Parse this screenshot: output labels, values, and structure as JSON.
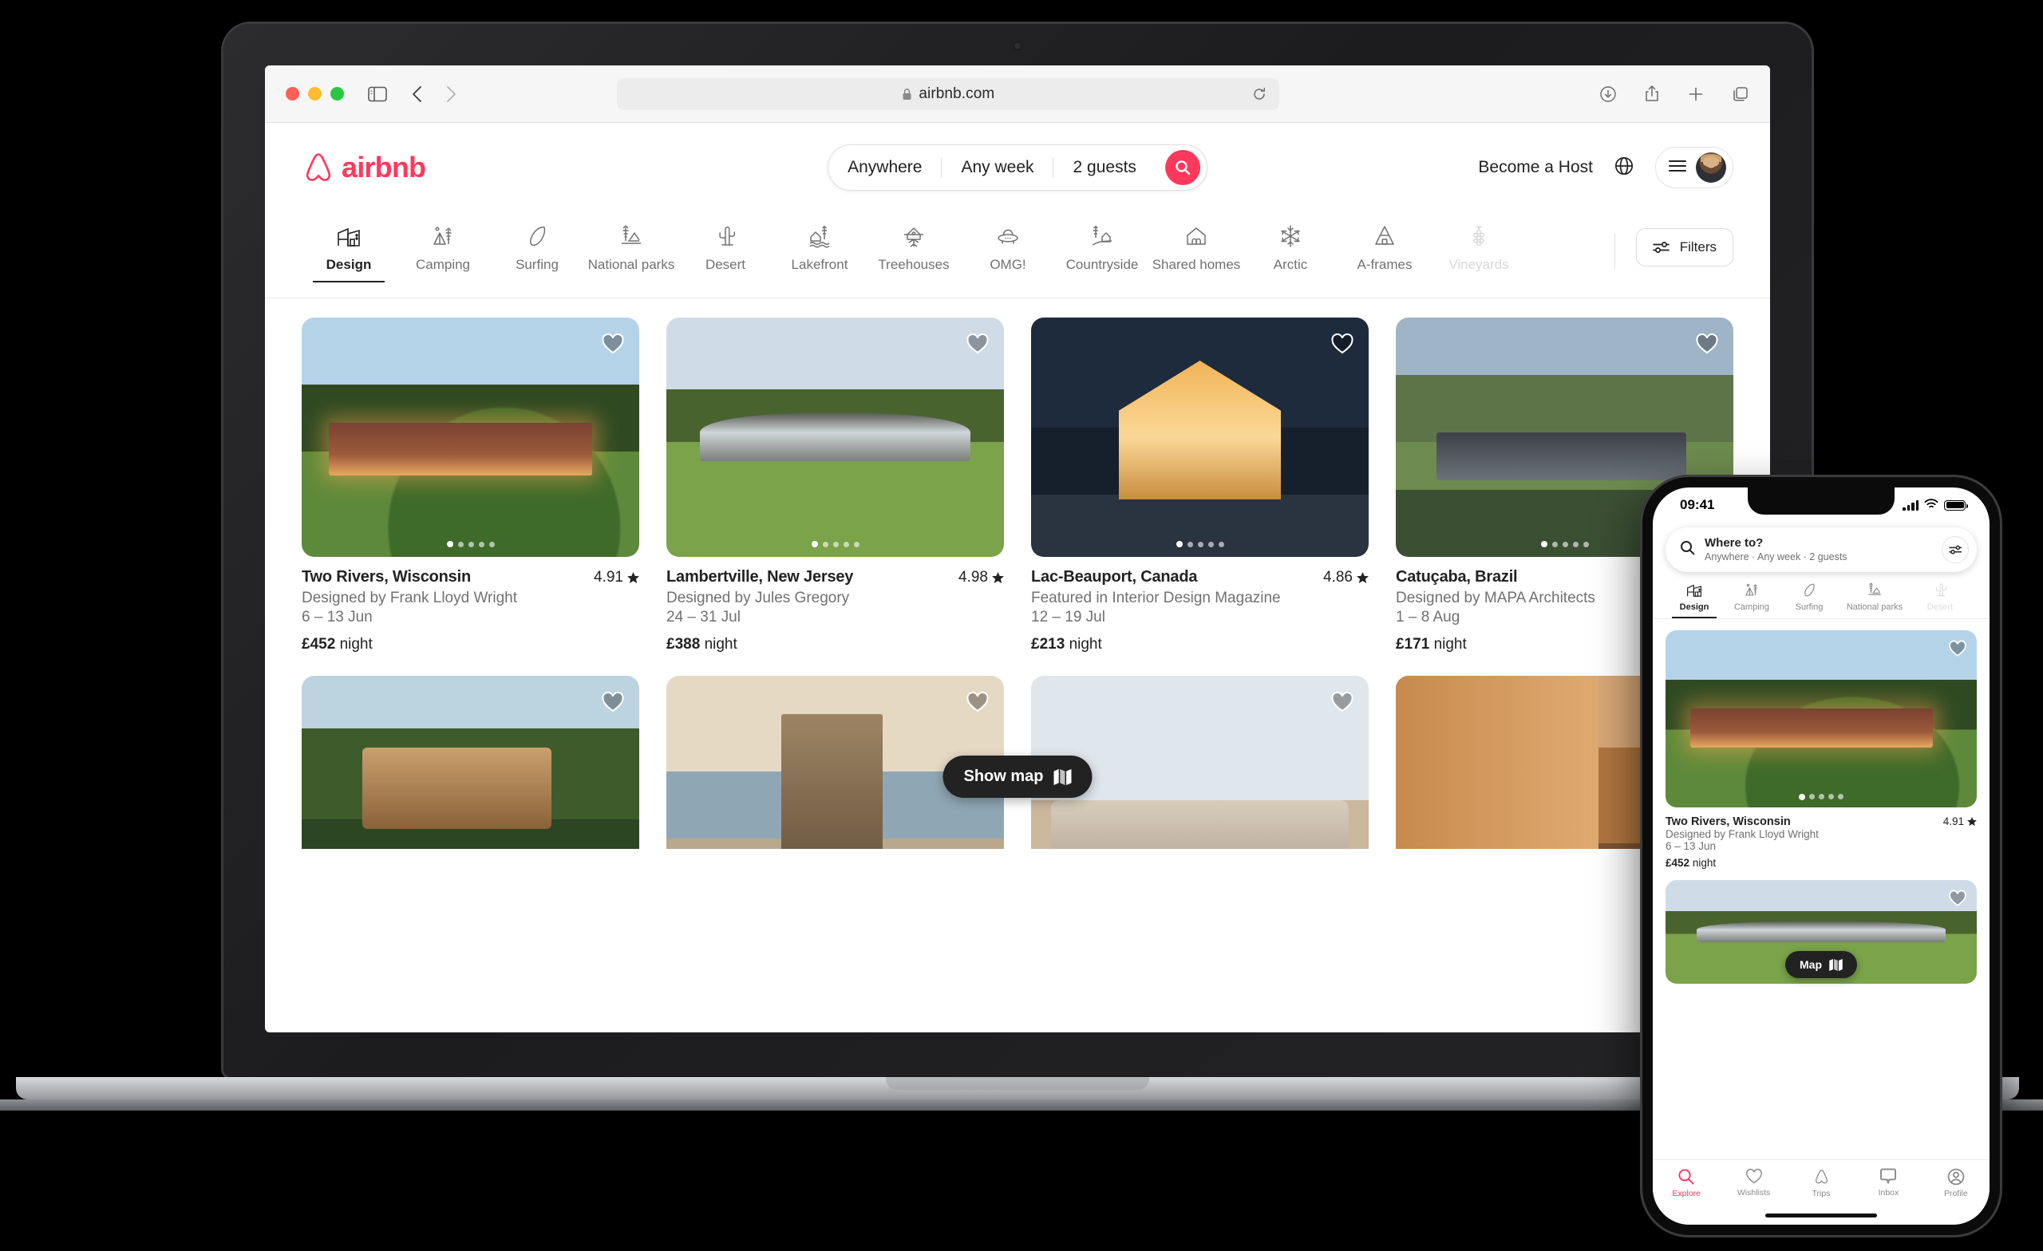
{
  "browser": {
    "url": "airbnb.com",
    "icons": {
      "sidebar": "sidebar-toggle-icon",
      "back": "back-arrow-icon",
      "forward": "forward-arrow-icon",
      "lock": "lock-icon",
      "reload": "reload-icon",
      "downloads": "downloads-icon",
      "share": "share-icon",
      "newtab": "plus-icon",
      "tabs": "tab-overview-icon"
    },
    "window_controls": [
      "close",
      "minimize",
      "zoom"
    ]
  },
  "site": {
    "brand": "airbnb",
    "search": {
      "location": "Anywhere",
      "dates": "Any week",
      "guests": "2 guests",
      "button": "search-icon"
    },
    "header": {
      "become_host": "Become a Host",
      "globe": "globe-icon",
      "menu": "hamburger-menu-icon",
      "avatar": "user-avatar"
    },
    "categories": [
      {
        "label": "Design",
        "icon": "design-building-icon",
        "active": true
      },
      {
        "label": "Camping",
        "icon": "camping-tent-icon",
        "active": false
      },
      {
        "label": "Surfing",
        "icon": "surfboard-icon",
        "active": false
      },
      {
        "label": "National parks",
        "icon": "national-park-icon",
        "active": false
      },
      {
        "label": "Desert",
        "icon": "cactus-icon",
        "active": false
      },
      {
        "label": "Lakefront",
        "icon": "lakefront-icon",
        "active": false
      },
      {
        "label": "Treehouses",
        "icon": "treehouse-icon",
        "active": false
      },
      {
        "label": "OMG!",
        "icon": "ufo-icon",
        "active": false
      },
      {
        "label": "Countryside",
        "icon": "countryside-icon",
        "active": false
      },
      {
        "label": "Shared homes",
        "icon": "shared-home-icon",
        "active": false
      },
      {
        "label": "Arctic",
        "icon": "snowflake-icon",
        "active": false
      },
      {
        "label": "A-frames",
        "icon": "a-frame-icon",
        "active": false
      },
      {
        "label": "Vineyards",
        "icon": "grapes-icon",
        "active": false
      }
    ],
    "filters_label": "Filters",
    "show_map_label": "Show map",
    "listings": [
      {
        "title": "Two Rivers, Wisconsin",
        "rating": "4.91",
        "subtitle": "Designed by Frank Lloyd Wright",
        "dates": "6 – 13 Jun",
        "price": "£452",
        "price_unit": "night",
        "photo_count": 5,
        "photo_index": 0,
        "liked": false
      },
      {
        "title": "Lambertville, New Jersey",
        "rating": "4.98",
        "subtitle": "Designed by Jules Gregory",
        "dates": "24 – 31 Jul",
        "price": "£388",
        "price_unit": "night",
        "photo_count": 5,
        "photo_index": 0,
        "liked": false
      },
      {
        "title": "Lac-Beauport, Canada",
        "rating": "4.86",
        "subtitle": "Featured in Interior Design Magazine",
        "dates": "12 – 19 Jul",
        "price": "£213",
        "price_unit": "night",
        "photo_count": 5,
        "photo_index": 0,
        "liked": false
      },
      {
        "title": "Catuçaba, Brazil",
        "rating": "",
        "subtitle": "Designed by MAPA Architects",
        "dates": "1 – 8 Aug",
        "price": "£171",
        "price_unit": "night",
        "photo_count": 5,
        "photo_index": 0,
        "liked": false
      }
    ]
  },
  "phone": {
    "status": {
      "time": "09:41",
      "signal": "cellular-signal-icon",
      "wifi": "wifi-icon",
      "battery": "battery-icon"
    },
    "search": {
      "title": "Where to?",
      "subtitle": "Anywhere · Any week · 2 guests",
      "search_icon": "search-icon",
      "filter_icon": "filter-icon"
    },
    "categories": [
      {
        "label": "Design",
        "icon": "design-building-icon",
        "active": true
      },
      {
        "label": "Camping",
        "icon": "camping-tent-icon",
        "active": false
      },
      {
        "label": "Surfing",
        "icon": "surfboard-icon",
        "active": false
      },
      {
        "label": "National parks",
        "icon": "national-park-icon",
        "active": false
      },
      {
        "label": "Desert",
        "icon": "cactus-icon",
        "active": false
      }
    ],
    "listing": {
      "title": "Two Rivers, Wisconsin",
      "rating": "4.91",
      "subtitle": "Designed by Frank Lloyd Wright",
      "dates": "6 – 13 Jun",
      "price": "£452",
      "price_unit": "night",
      "photo_count": 5,
      "photo_index": 0
    },
    "map_label": "Map",
    "tabs": [
      {
        "label": "Explore",
        "icon": "search-icon",
        "active": true
      },
      {
        "label": "Wishlists",
        "icon": "heart-icon",
        "active": false
      },
      {
        "label": "Trips",
        "icon": "airbnb-belo-icon",
        "active": false
      },
      {
        "label": "Inbox",
        "icon": "message-bubble-icon",
        "active": false
      },
      {
        "label": "Profile",
        "icon": "profile-circle-icon",
        "active": false
      }
    ]
  },
  "colors": {
    "brand": "#ff385c",
    "text": "#222222",
    "muted": "#717171",
    "dark_pill": "#222222"
  }
}
